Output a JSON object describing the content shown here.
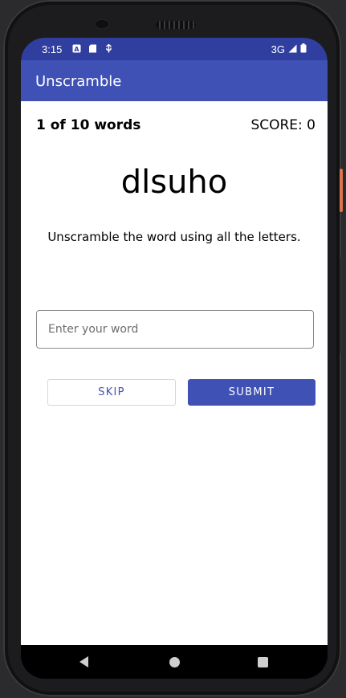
{
  "status_bar": {
    "time": "3:15",
    "network": "3G",
    "icons": [
      "a-icon",
      "sd-card-icon",
      "usb-icon"
    ]
  },
  "app_bar": {
    "title": "Unscramble"
  },
  "game": {
    "progress": "1 of 10 words",
    "score": "SCORE: 0",
    "scrambled_word": "dlsuho",
    "instructions": "Unscramble the word using all the letters.",
    "input_value": "",
    "input_placeholder": "Enter your word"
  },
  "actions": {
    "skip_label": "SKIP",
    "submit_label": "SUBMIT"
  },
  "colors": {
    "primary": "#3f51b5",
    "primary_dark": "#303f9f",
    "background": "#ffffff"
  }
}
